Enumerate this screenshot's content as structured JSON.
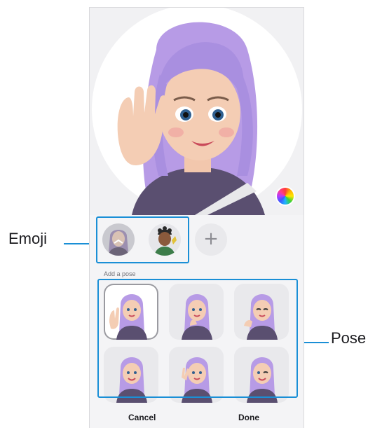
{
  "screen": {
    "pose_section_title": "Add a pose",
    "color_button_icon": "color-palette-icon",
    "add_emoji_icon": "plus-icon",
    "add_emoji_glyph": "+"
  },
  "bottom_bar": {
    "cancel_label": "Cancel",
    "done_label": "Done"
  },
  "emoji_list": {
    "items": [
      {
        "character": "purple-haired girl avatar",
        "selected": true
      },
      {
        "character": "boy avatar",
        "selected": false
      }
    ]
  },
  "poses": {
    "count": 6,
    "selected_index": 0
  },
  "callouts": {
    "emoji_label": "Emoji",
    "pose_label": "Pose",
    "accent": "#1a8fd6"
  },
  "colors": {
    "hair": "#b79be6",
    "shirt": "#5a4f70",
    "skin": "#f2c7ad"
  }
}
